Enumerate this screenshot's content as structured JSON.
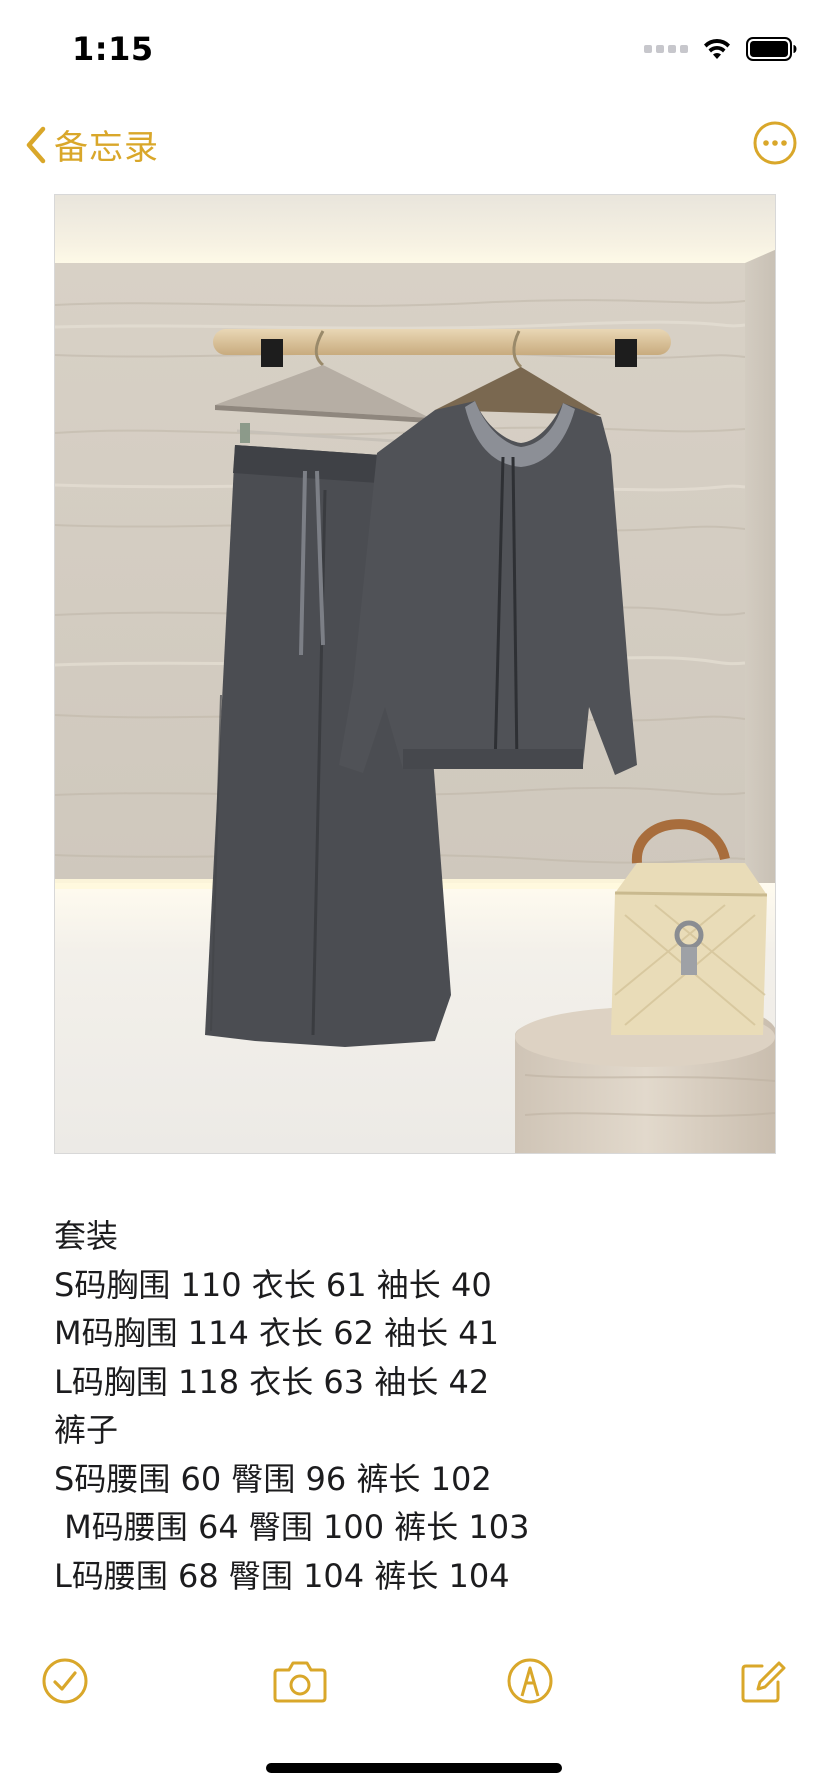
{
  "status_bar": {
    "time": "1:15",
    "signal_icon": "cellular-dots-icon",
    "wifi_icon": "wifi-icon",
    "battery_icon": "battery-icon"
  },
  "nav": {
    "back_label": "备忘录",
    "back_icon": "chevron-left-icon",
    "more_icon": "ellipsis-circle-icon"
  },
  "colors": {
    "accent": "#d9a72a",
    "text": "#1c1c1e",
    "background": "#ffffff"
  },
  "photo": {
    "icon": "attached-photo"
  },
  "note_lines": [
    "套装",
    "S码胸围 110 衣长 61 袖长 40",
    "M码胸围 114 衣长 62 袖长 41",
    "L码胸围 118 衣长 63 袖长 42",
    "裤子",
    "S码腰围 60 臀围 96 裤长 102",
    " M码腰围 64 臀围 100 裤长 103",
    "L码腰围 68 臀围 104 裤长 104"
  ],
  "toolbar": {
    "items": [
      "checklist-icon",
      "camera-icon",
      "markup-icon",
      "compose-icon"
    ]
  }
}
